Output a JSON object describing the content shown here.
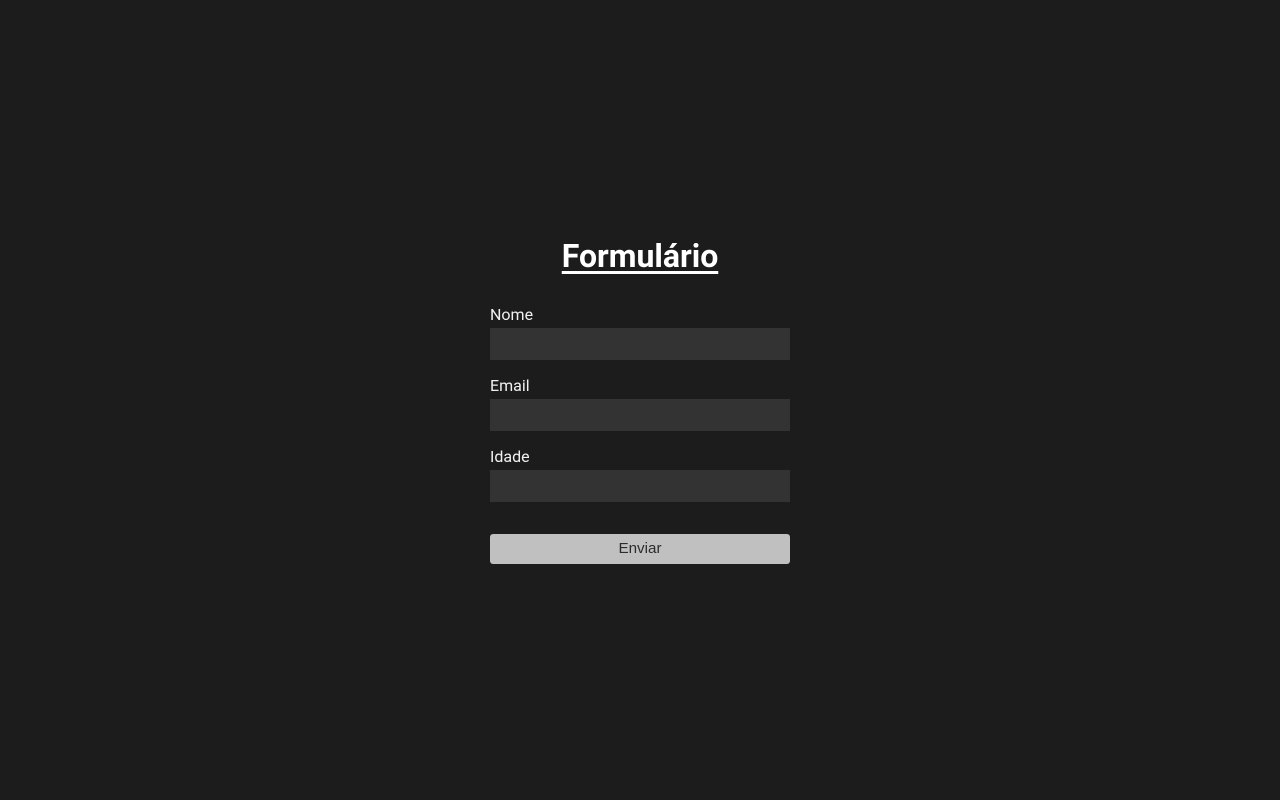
{
  "form": {
    "title": "Formulário",
    "fields": {
      "name": {
        "label": "Nome",
        "value": ""
      },
      "email": {
        "label": "Email",
        "value": ""
      },
      "age": {
        "label": "Idade",
        "value": ""
      }
    },
    "submit_label": "Enviar"
  }
}
